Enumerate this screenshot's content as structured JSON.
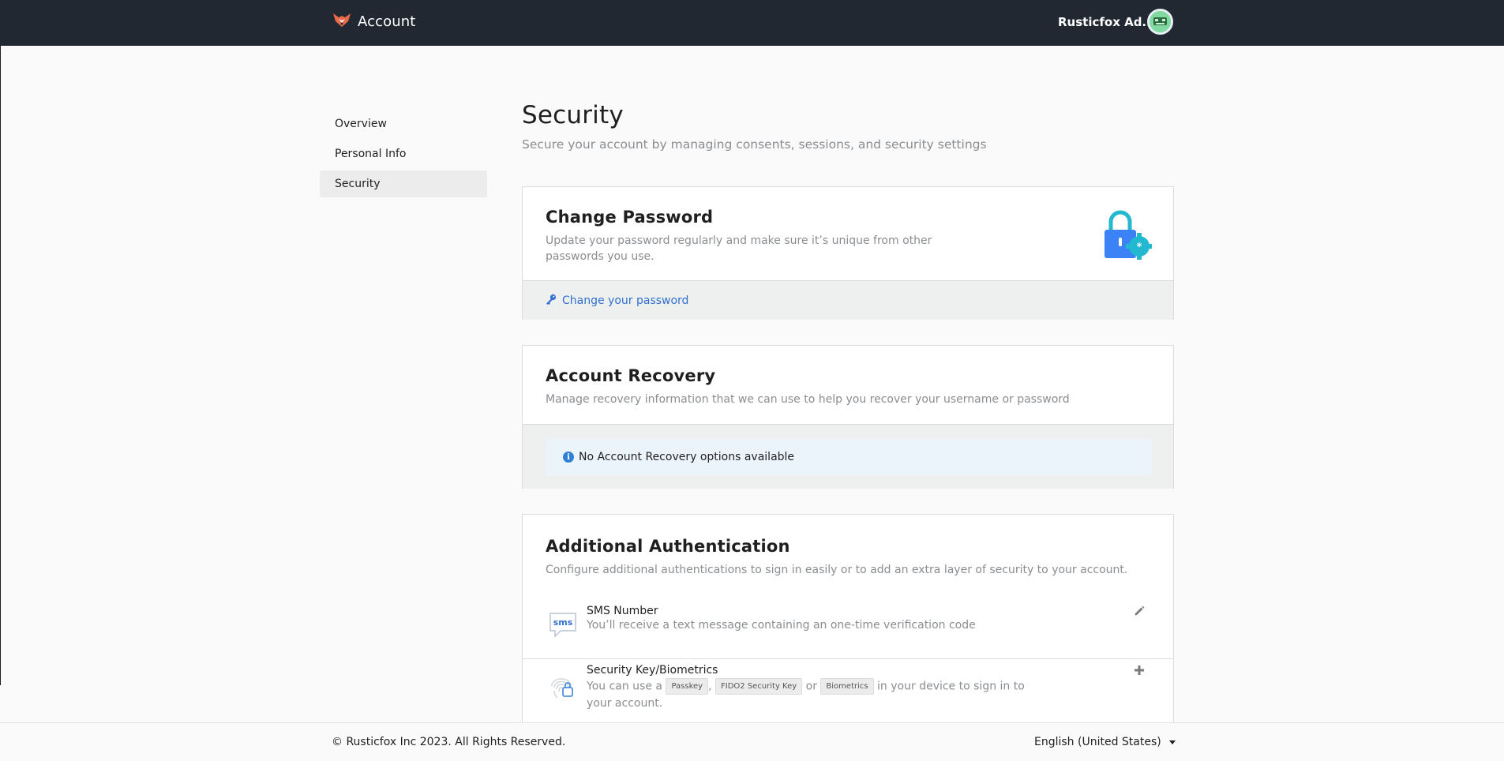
{
  "header": {
    "app_title": "Account",
    "user_name": "Rusticfox Ad...",
    "logo_icon": "fox-logo-icon",
    "avatar_icon": "robot-avatar-icon"
  },
  "sidebar": {
    "items": [
      {
        "label": "Overview",
        "active": false
      },
      {
        "label": "Personal Info",
        "active": false
      },
      {
        "label": "Security",
        "active": true
      }
    ]
  },
  "page": {
    "title": "Security",
    "subtitle": "Secure your account by managing consents, sessions, and security settings"
  },
  "change_password": {
    "title": "Change Password",
    "description": "Update your password regularly and make sure it’s unique from other passwords you use.",
    "link_label": "Change your password",
    "link_icon": "key-icon",
    "illustration": "lock-gear-illustration"
  },
  "account_recovery": {
    "title": "Account Recovery",
    "description": "Manage recovery information that we can use to help you recover your username or password",
    "alert_text": "No Account Recovery options available",
    "alert_icon": "info-icon"
  },
  "additional_auth": {
    "title": "Additional Authentication",
    "description": "Configure additional authentications to sign in easily or to add an extra layer of security to your account.",
    "sms": {
      "title": "SMS Number",
      "description": "You’ll receive a text message containing an one-time verification code",
      "icon_text": "sms",
      "action_icon": "pencil-icon"
    },
    "security_key": {
      "title": "Security Key/Biometrics",
      "desc_prefix": "You can use a",
      "chip1": "Passkey",
      "sep1": ",",
      "chip2": "FIDO2 Security Key",
      "sep2": "or",
      "chip3": "Biometrics",
      "desc_suffix": "in your device to sign in to your account.",
      "action_icon": "plus-icon"
    }
  },
  "footer": {
    "copyright": "© Rusticfox Inc 2023. All Rights Reserved.",
    "language": "English (United States)"
  },
  "colors": {
    "topbar": "#222831",
    "link": "#2f6fd0",
    "info": "#2f7fd6",
    "lock_blue": "#3b82f6",
    "lock_teal": "#22b8cf"
  }
}
